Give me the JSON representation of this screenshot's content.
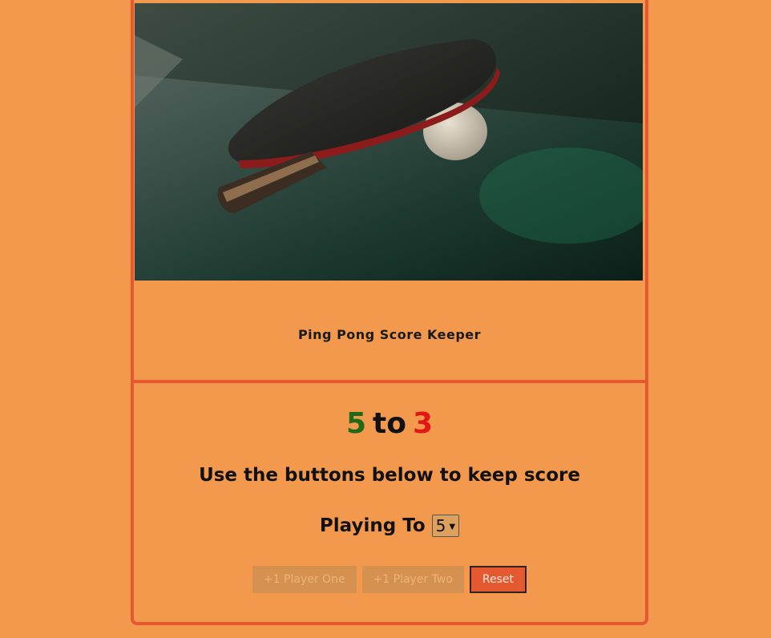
{
  "hero": {
    "image_alt": "ping pong paddle and ball on table"
  },
  "header": {
    "title": "Ping Pong Score Keeper"
  },
  "score": {
    "player_one": "5",
    "separator": "to",
    "player_two": "3"
  },
  "instructions": "Use the buttons below to keep score",
  "playing_to": {
    "label": "Playing To",
    "selected": "5"
  },
  "buttons": {
    "player_one": "+1 Player One",
    "player_two": "+1 Player Two",
    "reset": "Reset"
  },
  "colors": {
    "background": "#f2994e",
    "accent": "#e4592f",
    "player_one": "#1e6a17",
    "player_two": "#e31616"
  }
}
